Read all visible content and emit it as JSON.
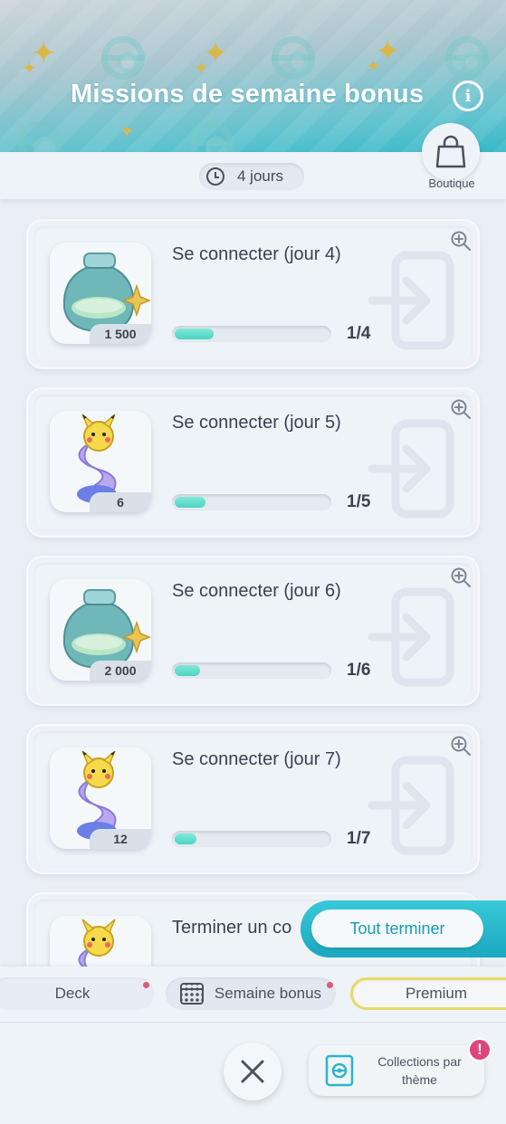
{
  "header": {
    "title": "Missions de semaine bonus",
    "info_label": "i",
    "timer": "4 jours",
    "shop_label": "Boutique"
  },
  "missions": [
    {
      "title": "Se connecter (jour 4)",
      "reward_qty": "1 500",
      "reward_type": "shinedust-jar",
      "progress_text": "1/4",
      "progress": 0.25
    },
    {
      "title": "Se connecter (jour 5)",
      "reward_qty": "6",
      "reward_type": "pikachu-hourglass",
      "progress_text": "1/5",
      "progress": 0.2
    },
    {
      "title": "Se connecter (jour 6)",
      "reward_qty": "2 000",
      "reward_type": "shinedust-jar",
      "progress_text": "1/6",
      "progress": 0.167
    },
    {
      "title": "Se connecter (jour 7)",
      "reward_qty": "12",
      "reward_type": "pikachu-hourglass",
      "progress_text": "1/7",
      "progress": 0.143
    },
    {
      "title": "Terminer un co",
      "reward_qty": "",
      "reward_type": "pikachu-hourglass",
      "progress_text": "",
      "progress": 0
    }
  ],
  "complete_all_label": "Tout terminer",
  "tabs": {
    "deck": "Deck",
    "week": "Semaine bonus",
    "premium": "Premium"
  },
  "bottom": {
    "collections_label_line1": "Collections par",
    "collections_label_line2": "thème",
    "alert_badge": "!"
  },
  "colors": {
    "accent_teal": "#1ba8c0",
    "progress_fill": "#4fd3c3",
    "notification": "#e0577c",
    "premium_border": "#e8d86a"
  }
}
